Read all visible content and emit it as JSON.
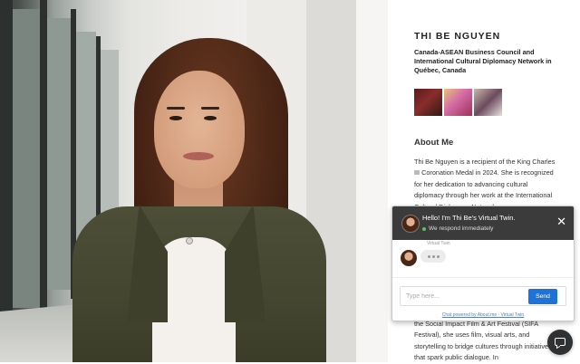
{
  "profile": {
    "name": "THI BE NGUYEN",
    "organization": "Canada-ASEAN Business Council and International Cultural Diplomacy Network in Québec, Canada",
    "section_title": "About Me",
    "bio": "Thi Be Nguyen is a recipient of the King Charles III Coronation Medal in 2024. She is recognized for her dedication to advancing cultural diplomacy through her work at the International Cultural Diplomacy Network",
    "bio_continued": "the Social Impact Film & Art Festival (SIFA Festival), she uses film, visual arts, and storytelling to bridge cultures through initiatives that spark public dialogue. In"
  },
  "chat": {
    "title": "Hello! I'm Thi Be's Virtual Twin.",
    "status": "We respond immediately",
    "sender_label": "Virtual Twin",
    "input_placeholder": "Type here...",
    "send_label": "Send",
    "close_symbol": "✕",
    "powered_by": "Chat powered by About.me - Virtual Twin"
  },
  "icons": {
    "close": "close-icon",
    "launcher": "chat-bubble-icon"
  },
  "colors": {
    "chat_header": "#3b3b3b",
    "send_button": "#1e73d8",
    "status_online": "#5fbf5f",
    "launcher": "#2f3133"
  }
}
